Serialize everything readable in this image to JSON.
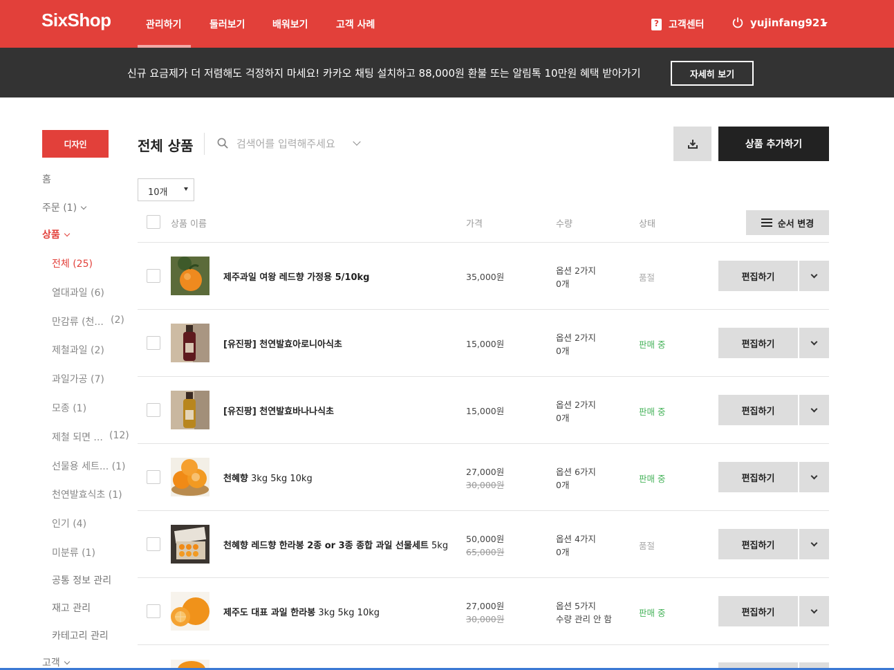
{
  "brand": {
    "logo": "SixShop",
    "accent": "#e2403a"
  },
  "nav": {
    "items": [
      "관리하기",
      "둘러보기",
      "배워보기",
      "고객 사례"
    ],
    "help": "고객센터",
    "username": "yujinfang921"
  },
  "banner": {
    "text": "신규 요금제가 더 저렴해도 걱정하지 마세요! 카카오 채팅 설치하고 88,000원 환불 또는 알림톡 10만원 혜택 받아가기",
    "button": "자세히 보기"
  },
  "sidebar": {
    "design_button": "디자인",
    "home": "홈",
    "orders": "주문 (1)",
    "products": "상품",
    "categories": [
      {
        "label": "전체",
        "count": "(25)"
      },
      {
        "label": "열대과일",
        "count": "(6)"
      },
      {
        "label": "만감류 (천...",
        "count": "(2)"
      },
      {
        "label": "제철과일",
        "count": "(2)"
      },
      {
        "label": "과일가공",
        "count": "(7)"
      },
      {
        "label": "모종",
        "count": "(1)"
      },
      {
        "label": "제철 되면 ...",
        "count": "(12)"
      },
      {
        "label": "선물용 세트...",
        "count": "(1)"
      },
      {
        "label": "천연발효식초",
        "count": "(1)"
      },
      {
        "label": "인기",
        "count": "(4)"
      },
      {
        "label": "미분류",
        "count": "(1)"
      }
    ],
    "links": [
      "공통 정보 관리",
      "재고 관리",
      "카테고리 관리"
    ],
    "customers": "고객"
  },
  "main": {
    "title": "전체 상품",
    "search_placeholder": "검색어를 입력해주세요",
    "add_button": "상품 추가하기",
    "per_page": "10개",
    "order_button": "순서 변경",
    "columns": {
      "name": "상품 이름",
      "price": "가격",
      "qty": "수량",
      "status": "상태"
    },
    "edit_label": "편집하기"
  },
  "products": [
    {
      "name_bold": "제주과일 여왕 레드향 가정용 5/10kg",
      "name_rest": "",
      "price": "35,000원",
      "orig": "",
      "qty1": "옵션 2가지",
      "qty2": "0개",
      "status": "품절",
      "status_type": "soldout",
      "thumb": "mandarin"
    },
    {
      "name_bold": "[유진팡] 천연발효아로니아식초",
      "name_rest": "",
      "price": "15,000원",
      "orig": "",
      "qty1": "옵션 2가지",
      "qty2": "0개",
      "status": "판매 중",
      "status_type": "onsale",
      "thumb": "darkbottle"
    },
    {
      "name_bold": "[유진팡] 천연발효바나나식초",
      "name_rest": "",
      "price": "15,000원",
      "orig": "",
      "qty1": "옵션 2가지",
      "qty2": "0개",
      "status": "판매 중",
      "status_type": "onsale",
      "thumb": "amberbottle"
    },
    {
      "name_bold": "천혜향",
      "name_rest": " 3kg 5kg 10kg",
      "price": "27,000원",
      "orig": "30,000원",
      "qty1": "옵션 6가지",
      "qty2": "0개",
      "status": "판매 중",
      "status_type": "onsale",
      "thumb": "oranges"
    },
    {
      "name_bold": "천혜향 레드향 한라봉 2종 or 3종 종합 과일 선물세트",
      "name_rest": " 5kg",
      "price": "50,000원",
      "orig": "65,000원",
      "qty1": "옵션 4가지",
      "qty2": "0개",
      "status": "품절",
      "status_type": "soldout",
      "thumb": "giftbox"
    },
    {
      "name_bold": "제주도 대표 과일 한라봉",
      "name_rest": " 3kg 5kg 10kg",
      "price": "27,000원",
      "orig": "30,000원",
      "qty1": "옵션 5가지",
      "qty2": "수량 관리 안 함",
      "status": "판매 중",
      "status_type": "onsale",
      "thumb": "hallabong"
    }
  ]
}
